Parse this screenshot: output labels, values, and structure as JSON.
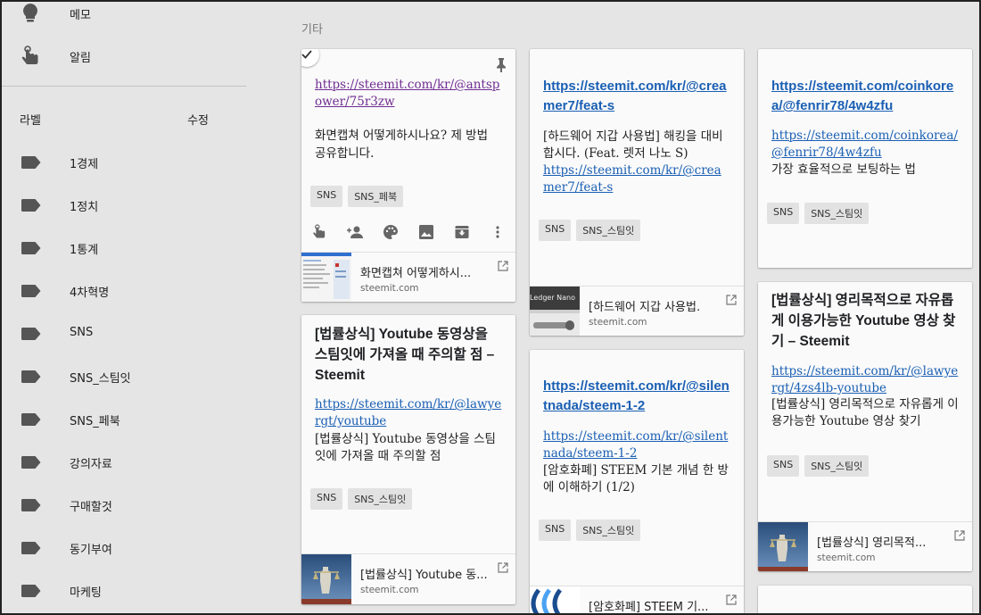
{
  "sidebar": {
    "nav": [
      {
        "label": "메모",
        "icon": "lightbulb-icon"
      },
      {
        "label": "알림",
        "icon": "reminder-hand-icon"
      }
    ],
    "labels_heading": "라벨",
    "edit_label": "수정",
    "labels": [
      "1경제",
      "1정치",
      "1통계",
      "4차혁명",
      "SNS",
      "SNS_스팀잇",
      "SNS_페북",
      "강의자료",
      "구매할것",
      "동기부여",
      "마케팅"
    ]
  },
  "main": {
    "section_title": "기타",
    "notes": [
      {
        "link": "https://steemit.com/kr/@antspower/75r3zw",
        "text": "화면캡쳐 어떻게하시나요? 제 방법 공유합니다.",
        "chips": [
          "SNS",
          "SNS_페북"
        ],
        "preview_title": "화면캡쳐 어떻게하시...",
        "preview_domain": "steemit.com"
      },
      {
        "title": "[법률상식] Youtube 동영상을 스팀잇에 가져올 때 주의할 점 – Steemit",
        "link": "https://steemit.com/kr/@lawyergt/youtube",
        "text": "[법률상식] Youtube 동영상을 스팀잇에 가져올 때 주의할 점",
        "chips": [
          "SNS",
          "SNS_스팀잇"
        ],
        "preview_title": "[법률상식] Youtube 동...",
        "preview_domain": "steemit.com"
      },
      {
        "bold_link": "https://steemit.com/kr/@creamer7/feat-s",
        "text": "[하드웨어 지갑 사용법] 해킹을 대비합시다. (Feat. 렛저 나노 S)",
        "link": "https://steemit.com/kr/@creamer7/feat-s",
        "chips": [
          "SNS",
          "SNS_스팀잇"
        ],
        "preview_title": "[하드웨어 지갑 사용법.",
        "preview_domain": "steemit.com"
      },
      {
        "bold_link": "https://steemit.com/kr/@silentnada/steem-1-2",
        "link": "https://steemit.com/kr/@silentnada/steem-1-2",
        "text": "[암호화폐] STEEM 기본 개념 한 방에 이해하기 (1/2)",
        "chips": [
          "SNS",
          "SNS_스팀잇"
        ],
        "preview_title": "[암호화폐] STEEM 기..."
      },
      {
        "bold_link": "https://steemit.com/coinkorea/@fenrir78/4w4zfu",
        "link": "https://steemit.com/coinkorea/@fenrir78/4w4zfu",
        "text": "가장 효율적으로 보팅하는 법",
        "chips": [
          "SNS",
          "SNS_스팀잇"
        ]
      },
      {
        "title": "[법률상식] 영리목적으로 자유롭게 이용가능한 Youtube 영상 찾기 – Steemit",
        "link": "https://steemit.com/kr/@lawyergt/4zs4lb-youtube",
        "text": "[법률상식] 영리목적으로 자유롭게 이용가능한 Youtube 영상 찾기",
        "chips": [
          "SNS",
          "SNS_스팀잇"
        ],
        "preview_title": "[법률상식] 영리목적...",
        "preview_domain": "steemit.com"
      }
    ]
  },
  "colors": {
    "link": "#1a5fb4",
    "visited_link": "#6f2d91",
    "background": "#e5e5e5",
    "card": "#fafafa"
  }
}
